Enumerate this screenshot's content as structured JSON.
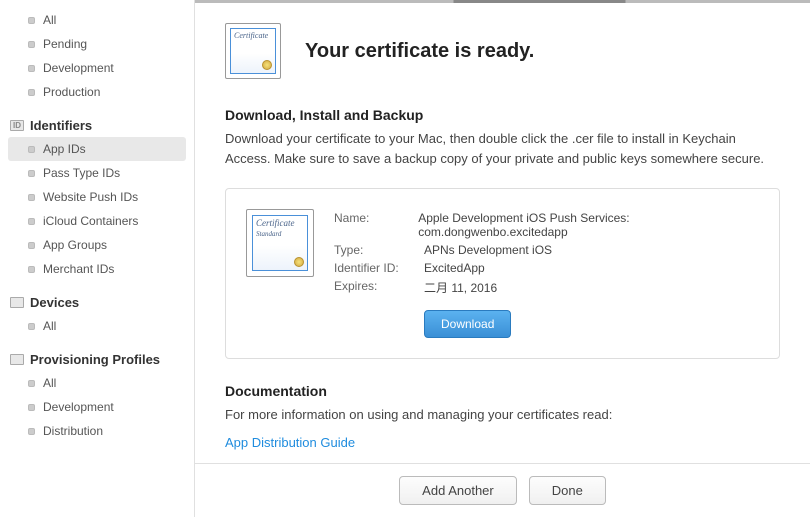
{
  "sidebar": {
    "top_items": [
      "All",
      "Pending",
      "Development",
      "Production"
    ],
    "sections": [
      {
        "title": "Identifiers",
        "items": [
          "App IDs",
          "Pass Type IDs",
          "Website Push IDs",
          "iCloud Containers",
          "App Groups",
          "Merchant IDs"
        ],
        "active_index": 0
      },
      {
        "title": "Devices",
        "items": [
          "All"
        ]
      },
      {
        "title": "Provisioning Profiles",
        "items": [
          "All",
          "Development",
          "Distribution"
        ]
      }
    ]
  },
  "header": {
    "icon_text": "Certificate",
    "title": "Your certificate is ready."
  },
  "download_section": {
    "title": "Download, Install and Backup",
    "text": "Download your certificate to your Mac, then double click the .cer file to install in Keychain Access. Make sure to save a backup copy of your private and public keys somewhere secure."
  },
  "cert": {
    "icon_text": "Certificate",
    "icon_sub": "Standard",
    "labels": {
      "name": "Name:",
      "type": "Type:",
      "identifier": "Identifier ID:",
      "expires": "Expires:"
    },
    "name": "Apple Development iOS Push Services: com.dongwenbo.excitedapp",
    "type": "APNs Development iOS",
    "identifier": "ExcitedApp",
    "expires": "二月 11, 2016",
    "download_label": "Download"
  },
  "documentation": {
    "title": "Documentation",
    "text": "For more information on using and managing your certificates read:",
    "link": "App Distribution Guide"
  },
  "footer": {
    "add_another": "Add Another",
    "done": "Done"
  }
}
